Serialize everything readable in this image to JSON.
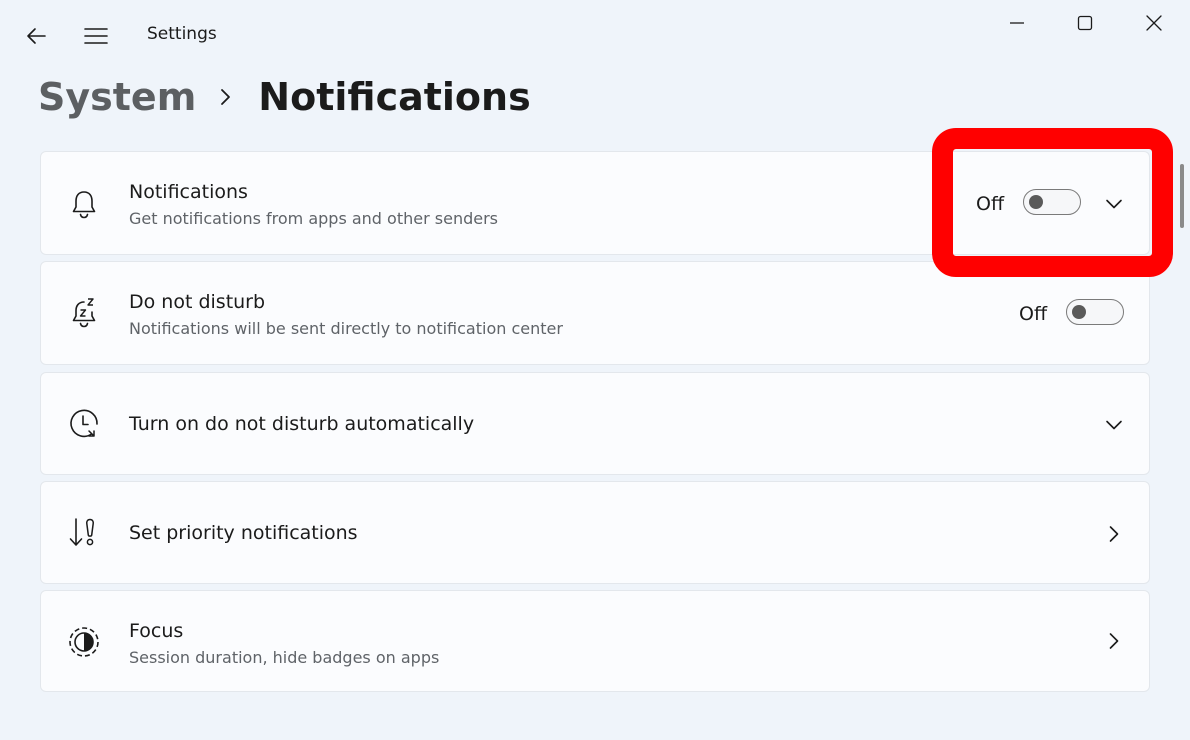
{
  "window": {
    "app_title": "Settings",
    "icons": {
      "back": "back-arrow-icon",
      "menu": "hamburger-menu-icon",
      "minimize": "minimize-icon",
      "maximize": "maximize-icon",
      "close": "close-icon"
    }
  },
  "breadcrumb": {
    "parent": "System",
    "current": "Notifications"
  },
  "cards": [
    {
      "title": "Notifications",
      "subtitle": "Get notifications from apps and other senders",
      "icon": "bell-icon",
      "state": "Off",
      "control": "toggle",
      "affordance": "expand-chevron"
    },
    {
      "title": "Do not disturb",
      "subtitle": "Notifications will be sent directly to notification center",
      "icon": "bell-snooze-icon",
      "state": "Off",
      "control": "toggle"
    },
    {
      "title": "Turn on do not disturb automatically",
      "icon": "clock-arrow-icon",
      "affordance": "expand-chevron"
    },
    {
      "title": "Set priority notifications",
      "icon": "sort-alert-icon",
      "affordance": "navigate-chevron"
    },
    {
      "title": "Focus",
      "subtitle": "Session duration, hide badges on apps",
      "icon": "focus-timer-icon",
      "affordance": "navigate-chevron"
    }
  ],
  "colors": {
    "highlight": "#ff0000",
    "background": "#eff4fa",
    "card": "#fbfcfe"
  }
}
